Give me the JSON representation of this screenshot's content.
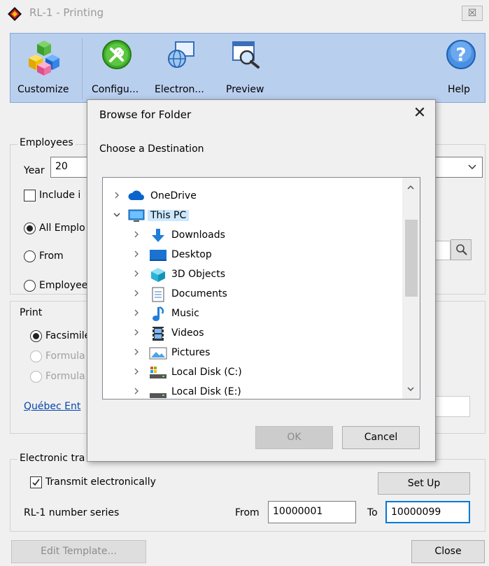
{
  "window": {
    "title": "RL-1 - Printing",
    "close_label": "☒"
  },
  "toolbar": {
    "items": [
      {
        "label": "Customize",
        "icon": "cubes-icon"
      },
      {
        "label": "Configu...",
        "icon": "tools-icon"
      },
      {
        "label": "Electron...",
        "icon": "globe-icon"
      },
      {
        "label": "Preview",
        "icon": "preview-icon"
      },
      {
        "label": "Help",
        "icon": "help-icon"
      }
    ]
  },
  "employees": {
    "group_label": "Employees",
    "year_label": "Year",
    "year_value": "20",
    "include_label": "Include i",
    "all_label": "All Emplo",
    "from_label": "From",
    "employee_label": "Employee"
  },
  "print": {
    "group_label": "Print",
    "facsimile_label": "Facsimile",
    "formula1_label": "Formula",
    "formula2_label": "Formula",
    "quebec_link": "Québec Ent"
  },
  "electronic": {
    "group_label": "Electronic tra",
    "transmit_label": "Transmit electronically",
    "setup_label": "Set Up",
    "series_label": "RL-1 number series",
    "from_label": "From",
    "from_value": "10000001",
    "to_label": "To",
    "to_value": "10000099"
  },
  "footer": {
    "edit_template_label": "Edit Template...",
    "close_label": "Close"
  },
  "dialog": {
    "title": "Browse for Folder",
    "close_label": "✕",
    "subtitle": "Choose a Destination",
    "tree": [
      {
        "label": "OneDrive",
        "icon": "onedrive-icon",
        "expanded": false
      },
      {
        "label": "This PC",
        "icon": "this-pc-icon",
        "expanded": true,
        "selected": true
      },
      {
        "label": "Downloads",
        "icon": "downloads-icon",
        "expanded": false
      },
      {
        "label": "Desktop",
        "icon": "desktop-icon",
        "expanded": false
      },
      {
        "label": "3D Objects",
        "icon": "3d-objects-icon",
        "expanded": false
      },
      {
        "label": "Documents",
        "icon": "documents-icon",
        "expanded": false
      },
      {
        "label": "Music",
        "icon": "music-icon",
        "expanded": false
      },
      {
        "label": "Videos",
        "icon": "videos-icon",
        "expanded": false
      },
      {
        "label": "Pictures",
        "icon": "pictures-icon",
        "expanded": false
      },
      {
        "label": "Local Disk (C:)",
        "icon": "local-disk-c-icon",
        "expanded": false
      },
      {
        "label": "Local Disk (E:)",
        "icon": "local-disk-e-icon",
        "expanded": false
      }
    ],
    "ok_label": "OK",
    "cancel_label": "Cancel"
  },
  "colors": {
    "toolbar_bg": "#b9cfee",
    "selection": "#cce8ff",
    "link": "#0645ad"
  }
}
